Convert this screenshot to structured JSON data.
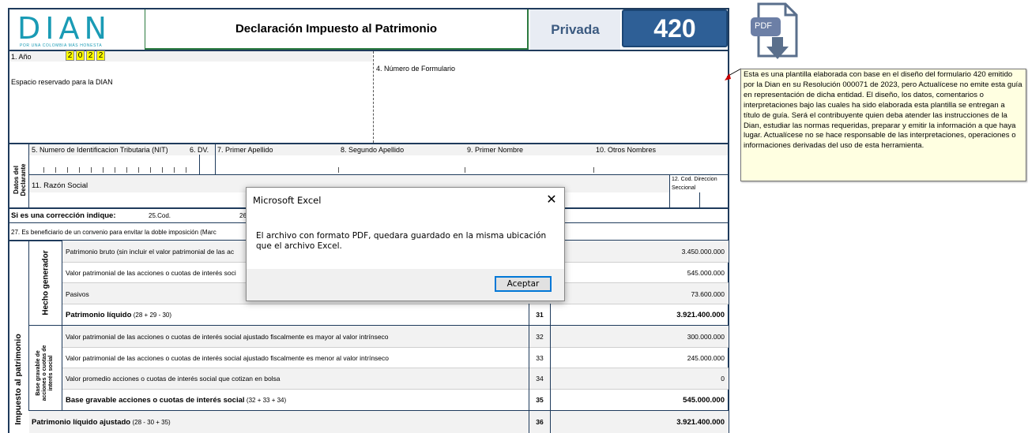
{
  "header": {
    "logo_text": "DIAN",
    "logo_subtitle": "POR UNA COLOMBIA MÁS HONESTA",
    "title": "Declaración Impuesto al Patrimonio",
    "privada": "Privada",
    "form_number": "420"
  },
  "year": {
    "label": "1. Año",
    "digits": [
      "2",
      "0",
      "2",
      "2"
    ]
  },
  "fields": {
    "reserved_space": "Espacio reservado para la DIAN",
    "form_number_label": "4. Número de Formulario",
    "nit": "5. Numero de Identificacion Tributaria (NIT)",
    "dv": "6. DV.",
    "primer_apellido": "7. Primer Apellido",
    "segundo_apellido": "8. Segundo Apellido",
    "primer_nombre": "9. Primer Nombre",
    "otros_nombres": "10. Otros Nombres",
    "razon_social": "11.  Razón Social",
    "cod_direccion_1": "12. Cod. Direccion",
    "cod_direccion_2": "Seccional",
    "declarante_1": "Datos del",
    "declarante_2": "Declarante",
    "correccion": "Si es una corrección indique:",
    "cod25": "25.Cod.",
    "cod26": "26",
    "convenio": "27. Es beneficiario de un convenio para envitar la doble imposición (Marc"
  },
  "sections": {
    "impuesto": "Impuesto al patrimonio",
    "hecho_generador": "Hecho generador",
    "base_gravable_1": "Base gravable de",
    "base_gravable_2": "acciones o cuotas de",
    "base_gravable_3": "interés social"
  },
  "rows": [
    {
      "label": "Patrimonio bruto (sin incluir el valor patrimonial de las ac",
      "num": "",
      "value": "3.450.000.000"
    },
    {
      "label": "Valor patrimonial de las acciones o cuotas de interés soci",
      "num": "",
      "value": "545.000.000"
    },
    {
      "label": "Pasivos",
      "num": "",
      "value": "73.600.000"
    },
    {
      "label": "Patrimonio líquido",
      "sub": "(28 + 29 - 30)",
      "num": "31",
      "value": "3.921.400.000"
    },
    {
      "label": "Valor patrimonial de las acciones o cuotas de interés social ajustado fiscalmente es mayor al valor intrínseco",
      "num": "32",
      "value": "300.000.000"
    },
    {
      "label": "Valor patrimonial de las acciones o cuotas de interés social ajustado fiscalmente es menor al valor intrínseco",
      "num": "33",
      "value": "245.000.000"
    },
    {
      "label": "Valor promedio acciones o cuotas de interés social que cotizan en bolsa",
      "num": "34",
      "value": "0"
    },
    {
      "label": "Base gravable acciones o cuotas de interés social",
      "sub": "(32 + 33 + 34)",
      "num": "35",
      "value": "545.000.000"
    },
    {
      "label": "Patrimonio líquido ajustado",
      "sub": "(28 - 30 + 35)",
      "num": "36",
      "value": "3.921.400.000"
    }
  ],
  "pdf_icon": {
    "label": "PDF",
    "icon": "pdf-export-icon"
  },
  "note": "Esta es una plantilla elaborada con base en el diseño del formulario 420 emitido por la Dian en su Resolución 000071 de 2023, pero Actualícese no emite esta guía en representación de dicha entidad. El diseño, los datos, comentarios o interpretaciones bajo las cuales ha sido elaborada esta plantilla se entregan a título de guía. Será el contribuyente quien deba atender las instrucciones de la Dian, estudiar las normas requeridas, preparar y emitir la información a que haya lugar. Actualícese no se hace responsable de las interpretaciones, operaciones o informaciones derivadas del uso de esta herramienta.",
  "dialog": {
    "title": "Microsoft Excel",
    "message": "El archivo con formato PDF, quedara guardado en la misma ubicación que el archivo Excel.",
    "ok_label": "Aceptar",
    "close_glyph": "✕"
  }
}
